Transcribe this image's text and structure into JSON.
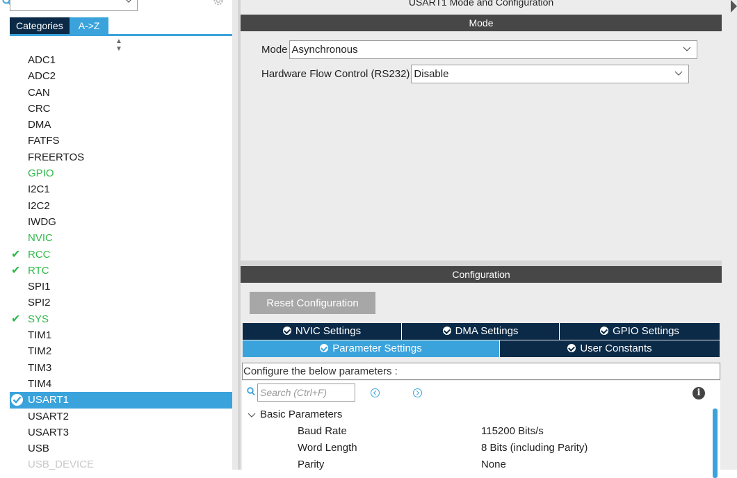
{
  "left_panel": {
    "tabs": {
      "categories": "Categories",
      "az": "A->Z"
    },
    "peripherals": [
      {
        "label": "ADC1",
        "state": "normal"
      },
      {
        "label": "ADC2",
        "state": "normal"
      },
      {
        "label": "CAN",
        "state": "normal"
      },
      {
        "label": "CRC",
        "state": "normal"
      },
      {
        "label": "DMA",
        "state": "normal"
      },
      {
        "label": "FATFS",
        "state": "normal"
      },
      {
        "label": "FREERTOS",
        "state": "normal"
      },
      {
        "label": "GPIO",
        "state": "green"
      },
      {
        "label": "I2C1",
        "state": "normal"
      },
      {
        "label": "I2C2",
        "state": "normal"
      },
      {
        "label": "IWDG",
        "state": "normal"
      },
      {
        "label": "NVIC",
        "state": "green"
      },
      {
        "label": "RCC",
        "state": "checked"
      },
      {
        "label": "RTC",
        "state": "checked"
      },
      {
        "label": "SPI1",
        "state": "normal"
      },
      {
        "label": "SPI2",
        "state": "normal"
      },
      {
        "label": "SYS",
        "state": "checked"
      },
      {
        "label": "TIM1",
        "state": "normal"
      },
      {
        "label": "TIM2",
        "state": "normal"
      },
      {
        "label": "TIM3",
        "state": "normal"
      },
      {
        "label": "TIM4",
        "state": "normal"
      },
      {
        "label": "USART1",
        "state": "selected"
      },
      {
        "label": "USART2",
        "state": "normal"
      },
      {
        "label": "USART3",
        "state": "normal"
      },
      {
        "label": "USB",
        "state": "normal"
      },
      {
        "label": "USB_DEVICE",
        "state": "faded"
      }
    ]
  },
  "main": {
    "title": "USART1 Mode and Configuration",
    "mode_header": "Mode",
    "mode_label": "Mode",
    "mode_value": "Asynchronous",
    "flow_label": "Hardware Flow Control (RS232)",
    "flow_value": "Disable",
    "config_header": "Configuration",
    "reset_button": "Reset Configuration",
    "tabs_row1": [
      "NVIC Settings",
      "DMA Settings",
      "GPIO Settings"
    ],
    "tabs_row2": [
      "Parameter Settings",
      "User Constants"
    ],
    "active_tab": "Parameter Settings",
    "config_message": "Configure the below parameters :",
    "search_placeholder": "Search (Ctrl+F)",
    "group_label": "Basic Parameters",
    "params": [
      {
        "name": "Baud Rate",
        "value": "115200 Bits/s"
      },
      {
        "name": "Word Length",
        "value": "8 Bits (including Parity)"
      },
      {
        "name": "Parity",
        "value": "None"
      }
    ]
  },
  "colors": {
    "accent": "#3aa3dc",
    "dark_navy": "#0b2a47",
    "header_gray": "#474747",
    "green": "#2fb84a"
  }
}
